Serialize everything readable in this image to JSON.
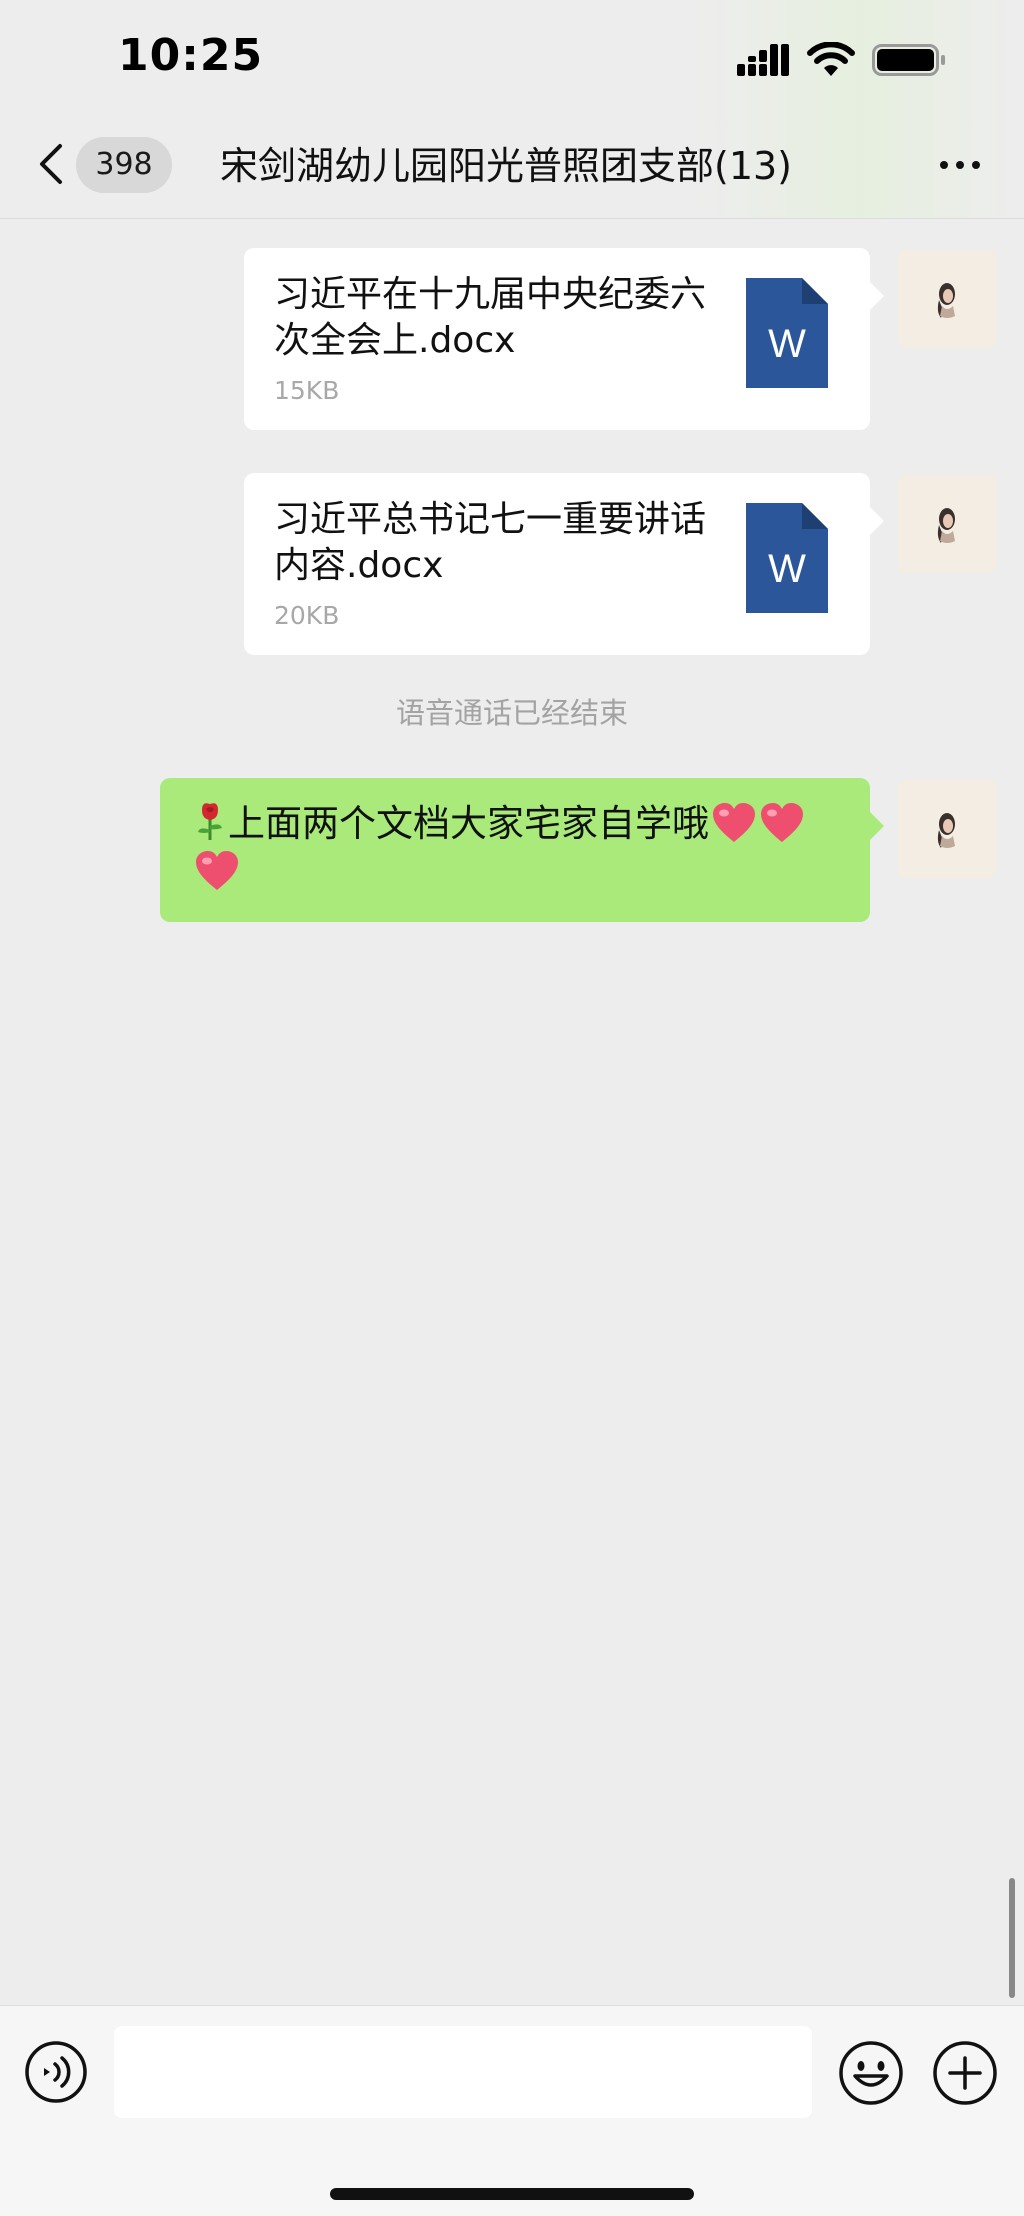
{
  "status_bar": {
    "time": "10:25"
  },
  "header": {
    "back_count": "398",
    "title": "宋剑湖幼儿园阳光普照团支部(13)"
  },
  "messages": [
    {
      "type": "file",
      "file_name": "习近平在十九届中央纪委六次全会上.docx",
      "file_size": "15KB",
      "icon": "word-file-icon",
      "icon_letter": "W"
    },
    {
      "type": "file",
      "file_name": "习近平总书记七一重要讲话内容.docx",
      "file_size": "20KB",
      "icon": "word-file-icon",
      "icon_letter": "W"
    },
    {
      "type": "system",
      "text": "语音通话已经结束"
    },
    {
      "type": "text",
      "text": "上面两个文档大家宅家自学哦"
    }
  ],
  "input": {
    "placeholder": ""
  },
  "colors": {
    "chat_background": "#ededed",
    "own_bubble": "#a9ea7a",
    "file_bubble": "#ffffff",
    "word_icon_blue": "#2b579a"
  }
}
